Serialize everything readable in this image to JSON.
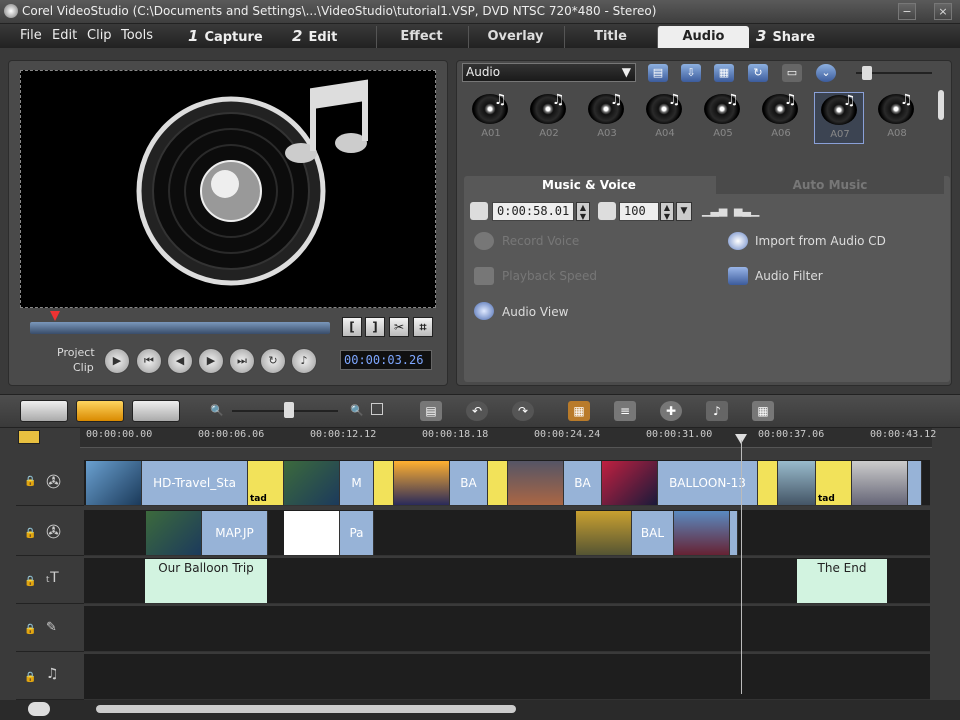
{
  "titlebar": {
    "text": "Corel VideoStudio (C:\\Documents and Settings\\...\\VideoStudio\\tutorial1.VSP, DVD NTSC 720*480 - Stereo)",
    "minimize": "−",
    "close": "×"
  },
  "menu": {
    "file": "File",
    "edit": "Edit",
    "clip": "Clip",
    "tools": "Tools"
  },
  "steps": [
    {
      "num": "1",
      "label": "Capture"
    },
    {
      "num": "2",
      "label": "Edit"
    },
    {
      "num": "3",
      "label": "Share"
    }
  ],
  "tabs": [
    "Effect",
    "Overlay",
    "Title",
    "Audio"
  ],
  "preview": {
    "project_label": "Project",
    "clip_label": "Clip",
    "timecode": "00:00:03.26",
    "mark_in": "[",
    "mark_out": "]"
  },
  "library": {
    "category": "Audio",
    "thumbs": [
      "A01",
      "A02",
      "A03",
      "A04",
      "A05",
      "A06",
      "A07",
      "A08"
    ],
    "selected": "A07"
  },
  "options": {
    "tab_music": "Music & Voice",
    "tab_auto": "Auto Music",
    "duration": "0:00:58.01",
    "volume": "100",
    "record_voice": "Record Voice",
    "playback_speed": "Playback Speed",
    "audio_view": "Audio View",
    "import_cd": "Import from Audio CD",
    "audio_filter": "Audio Filter"
  },
  "ruler": [
    "00:00:00.00",
    "00:00:06.06",
    "00:00:12.12",
    "00:00:18.18",
    "00:00:24.24",
    "00:00:31.00",
    "00:00:37.06",
    "00:00:43.12"
  ],
  "video_track": {
    "hd_travel": "HD-Travel_Sta",
    "m": "M",
    "ba1": "BA",
    "ba2": "BA",
    "balloon": "BALLOON-13"
  },
  "overlay_track": {
    "map": "MAP.JP",
    "pa": "Pa",
    "bal": "BAL"
  },
  "title_track": {
    "t1": "Our Balloon Trip",
    "t2": "The End"
  },
  "tad": "tad"
}
